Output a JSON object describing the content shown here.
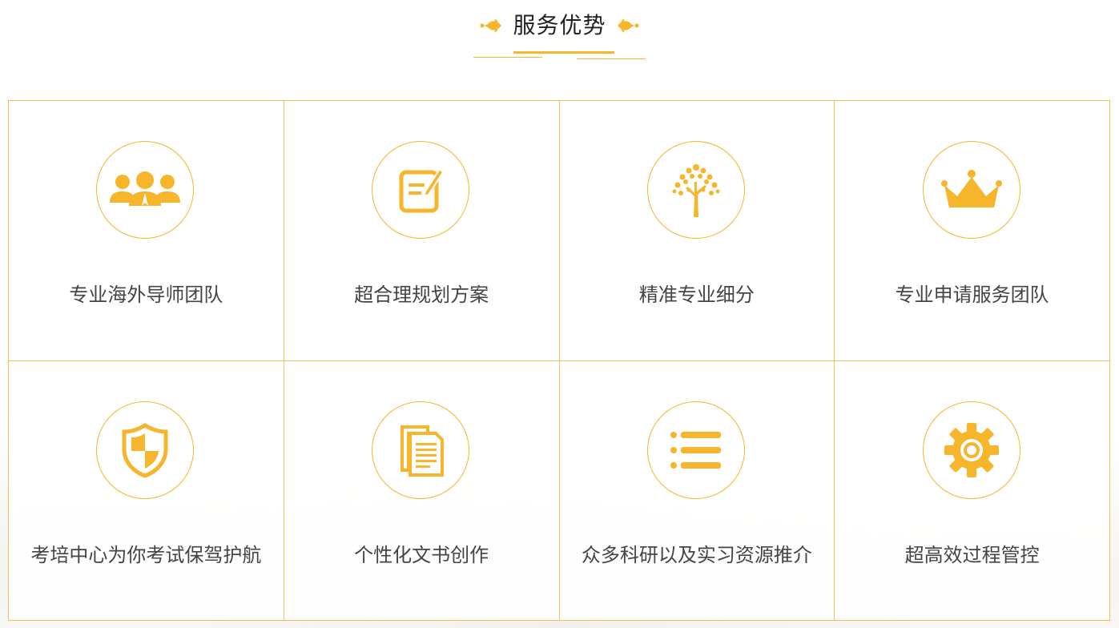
{
  "section": {
    "title": "服务优势",
    "accent_color": "#f6b52a"
  },
  "items": [
    {
      "label": "专业海外导师团队",
      "icon": "team-icon"
    },
    {
      "label": "超合理规划方案",
      "icon": "edit-document-icon"
    },
    {
      "label": "精准专业细分",
      "icon": "tree-icon"
    },
    {
      "label": "专业申请服务团队",
      "icon": "crown-icon"
    },
    {
      "label": "考培中心为你考试保驾护航",
      "icon": "shield-icon"
    },
    {
      "label": "个性化文书创作",
      "icon": "documents-icon"
    },
    {
      "label": "众多科研以及实习资源推介",
      "icon": "list-icon"
    },
    {
      "label": "超高效过程管控",
      "icon": "gear-icon"
    }
  ]
}
